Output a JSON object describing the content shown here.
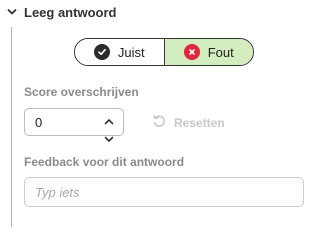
{
  "section": {
    "title": "Leeg antwoord",
    "chevron_icon": "chevron-down-icon"
  },
  "toggle": {
    "correct_label": "Juist",
    "correct_icon": "check-circle-icon",
    "wrong_label": "Fout",
    "wrong_icon": "x-circle-icon",
    "selected": "Fout"
  },
  "score": {
    "label": "Score overschrijven",
    "value": "0"
  },
  "reset": {
    "label": "Resetten",
    "icon": "reset-icon"
  },
  "feedback": {
    "label": "Feedback voor dit antwoord",
    "placeholder": "Typ iets",
    "value": ""
  },
  "colors": {
    "accent": "#9bd15c",
    "selected_bg": "#d3edbe",
    "wrong_icon": "#e0263c"
  }
}
